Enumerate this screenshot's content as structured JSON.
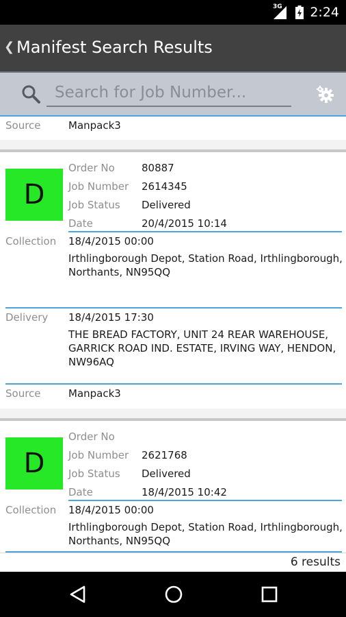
{
  "status_bar": {
    "time": "2:24",
    "network": "3G"
  },
  "action_bar": {
    "title": "Manifest Search Results"
  },
  "search": {
    "placeholder": "Search for Job Number..."
  },
  "labels": {
    "order_no": "Order No",
    "job_number": "Job Number",
    "job_status": "Job Status",
    "date": "Date",
    "collection": "Collection",
    "delivery": "Delivery",
    "source": "Source"
  },
  "partial_top": {
    "source": "Manpack3"
  },
  "records": [
    {
      "badge": "D",
      "order_no": "80887",
      "job_number": "2614345",
      "job_status": "Delivered",
      "date": "20/4/2015 10:14",
      "collection_date": "18/4/2015 00:00",
      "collection_address_1": "Irthlingborough Depot, Station Road, Irthlingborough,",
      "collection_address_2": "Northants, NN95QQ",
      "delivery_date": "18/4/2015 17:30",
      "delivery_address_1": "THE BREAD FACTORY, UNIT 24 REAR WAREHOUSE,",
      "delivery_address_2": "GARRICK ROAD IND. ESTATE, IRVING WAY, HENDON,",
      "delivery_address_3": "NW96AQ",
      "source": "Manpack3"
    },
    {
      "badge": "D",
      "order_no": "",
      "job_number": "2621768",
      "job_status": "Delivered",
      "date": "18/4/2015 10:42",
      "collection_date": "18/4/2015 00:00",
      "collection_address_1": "Irthlingborough Depot, Station Road, Irthlingborough,",
      "collection_address_2": "Northants, NN95QQ"
    }
  ],
  "footer": {
    "count": "6 results"
  },
  "colors": {
    "action_bar": "#414141",
    "search_bar": "#c4c9d1",
    "accent_line": "#4fa3dc",
    "badge": "#27e827"
  }
}
